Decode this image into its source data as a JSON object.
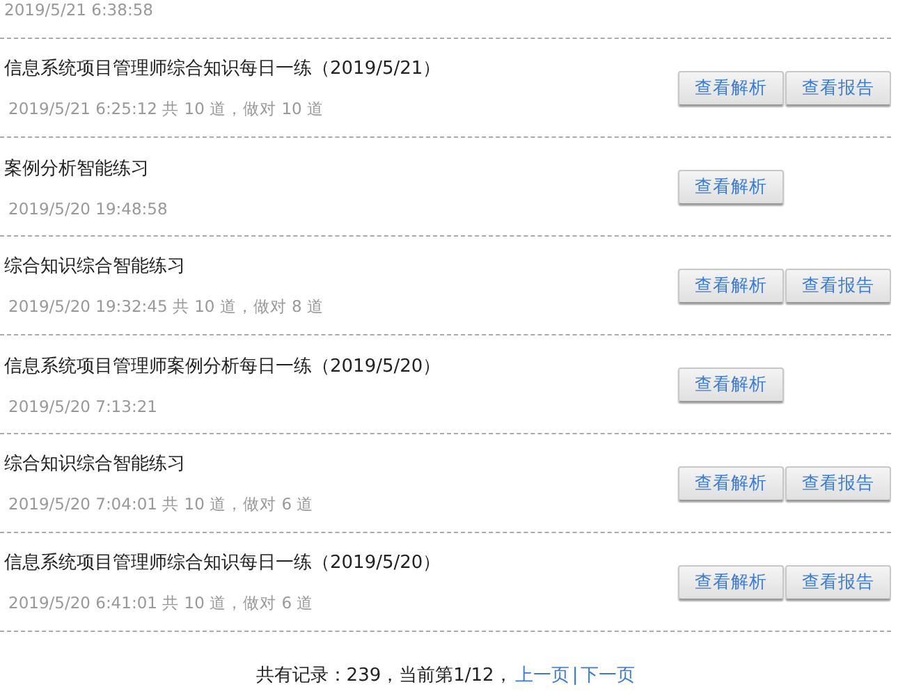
{
  "partial_record": {
    "meta": "2019/5/21 6:38:58"
  },
  "records": [
    {
      "title": "信息系统项目管理师综合知识每日一练（2019/5/21）",
      "meta": "2019/5/21 6:25:12 共 10 道，做对 10 道",
      "buttons": [
        "查看解析",
        "查看报告"
      ]
    },
    {
      "title": "案例分析智能练习",
      "meta": "2019/5/20 19:48:58",
      "buttons": [
        "查看解析"
      ]
    },
    {
      "title": "综合知识综合智能练习",
      "meta": "2019/5/20 19:32:45 共 10 道，做对 8 道",
      "buttons": [
        "查看解析",
        "查看报告"
      ]
    },
    {
      "title": "信息系统项目管理师案例分析每日一练（2019/5/20）",
      "meta": "2019/5/20 7:13:21",
      "buttons": [
        "查看解析"
      ]
    },
    {
      "title": "综合知识综合智能练习",
      "meta": "2019/5/20 7:04:01 共 10 道，做对 6 道",
      "buttons": [
        "查看解析",
        "查看报告"
      ]
    },
    {
      "title": "信息系统项目管理师综合知识每日一练（2019/5/20）",
      "meta": "2019/5/20 6:41:01 共 10 道，做对 6 道",
      "buttons": [
        "查看解析",
        "查看报告"
      ]
    }
  ],
  "pagination": {
    "summary": "共有记录：239，当前第1/12，",
    "prev": "上一页",
    "separator": "|",
    "next": "下一页"
  }
}
